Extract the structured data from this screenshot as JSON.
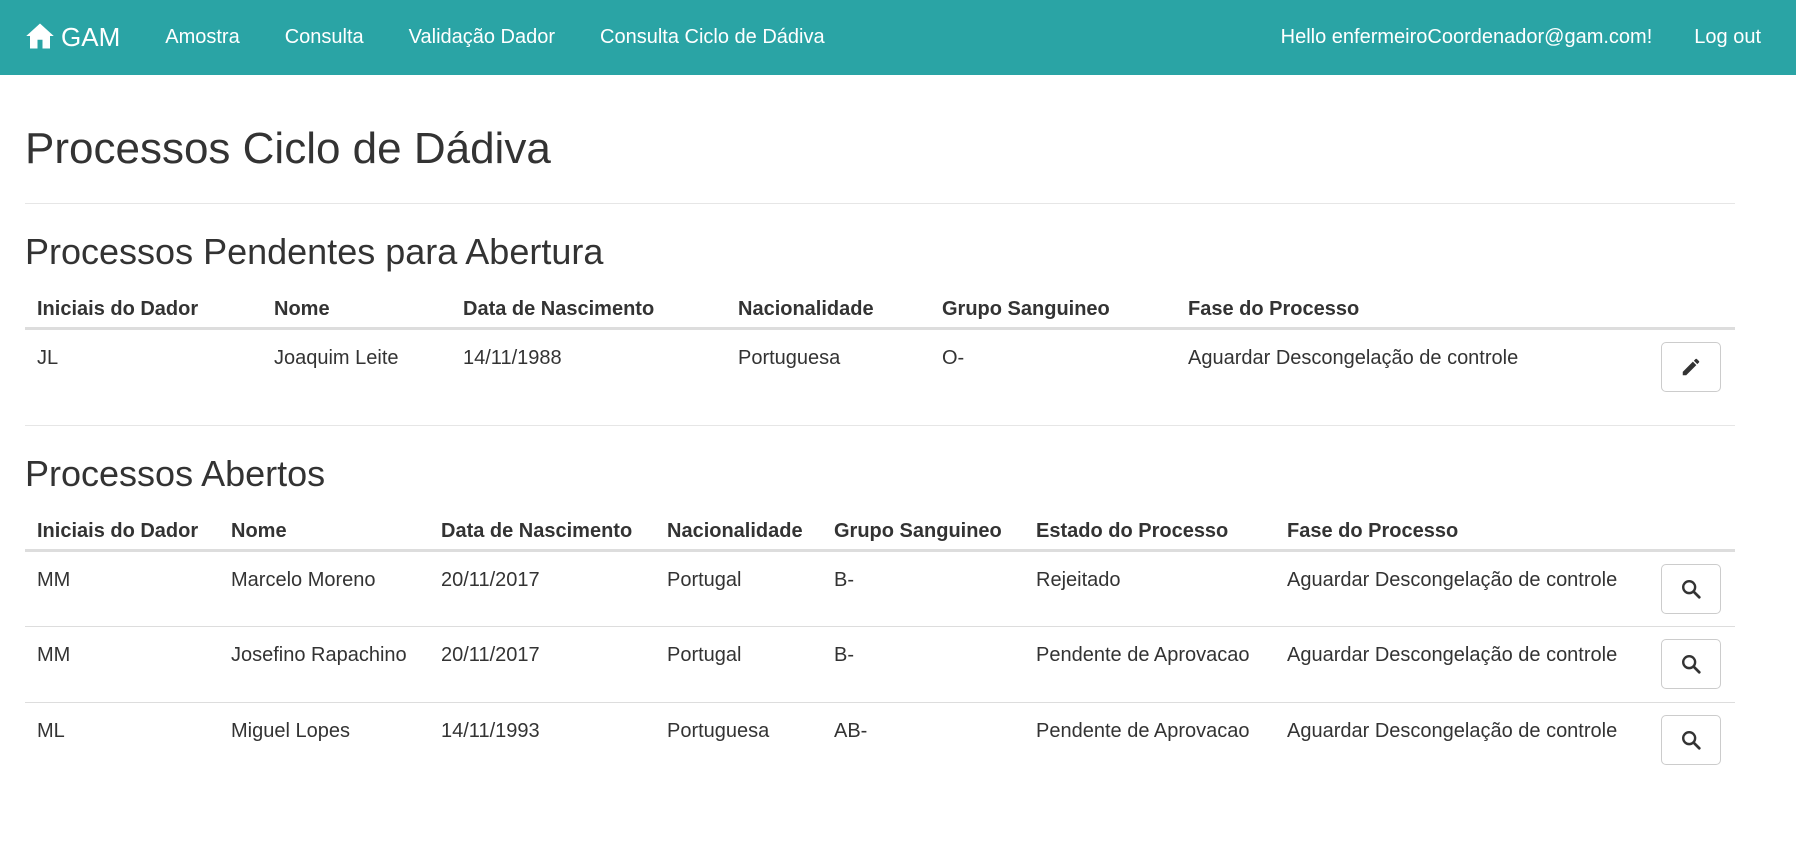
{
  "nav": {
    "brand": "GAM",
    "links": [
      "Amostra",
      "Consulta",
      "Validação Dador",
      "Consulta Ciclo de Dádiva"
    ],
    "hello": "Hello enfermeiroCoordenador@gam.com!",
    "logout": "Log out"
  },
  "page": {
    "title": "Processos Ciclo de Dádiva"
  },
  "pending": {
    "title": "Processos Pendentes para Abertura",
    "headers": [
      "Iniciais do Dador",
      "Nome",
      "Data de Nascimento",
      "Nacionalidade",
      "Grupo Sanguineo",
      "Fase do Processo"
    ],
    "rows": [
      [
        "JL",
        "Joaquim Leite",
        "14/11/1988",
        "Portuguesa",
        "O-",
        "Aguardar Descongelação de controle"
      ]
    ],
    "action_icon": "pencil-icon"
  },
  "open": {
    "title": "Processos Abertos",
    "headers": [
      "Iniciais do Dador",
      "Nome",
      "Data de Nascimento",
      "Nacionalidade",
      "Grupo Sanguineo",
      "Estado do Processo",
      "Fase do Processo"
    ],
    "rows": [
      [
        "MM",
        "Marcelo Moreno",
        "20/11/2017",
        "Portugal",
        "B-",
        "Rejeitado",
        "Aguardar Descongelação de controle"
      ],
      [
        "MM",
        "Josefino Rapachino",
        "20/11/2017",
        "Portugal",
        "B-",
        "Pendente de Aprovacao",
        "Aguardar Descongelação de controle"
      ],
      [
        "ML",
        "Miguel Lopes",
        "14/11/1993",
        "Portuguesa",
        "AB-",
        "Pendente de Aprovacao",
        "Aguardar Descongelação de controle"
      ]
    ],
    "action_icon": "search-icon"
  },
  "colors": {
    "navbar": "#2aa4a5",
    "text": "#333333",
    "border": "#dddddd"
  }
}
